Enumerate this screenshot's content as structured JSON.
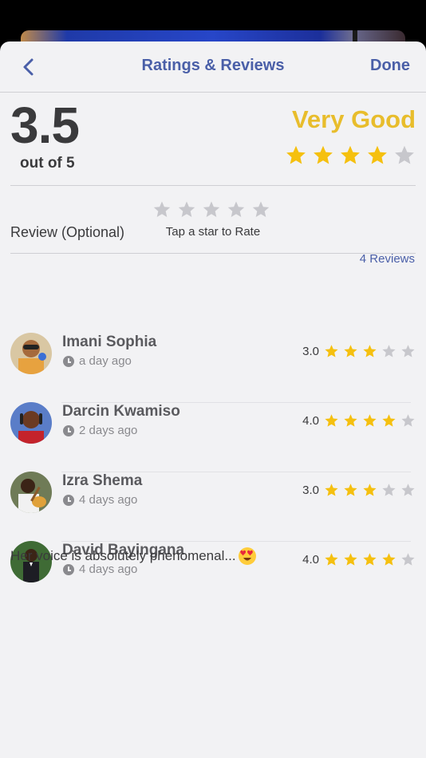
{
  "nav": {
    "title": "Ratings & Reviews",
    "done_label": "Done",
    "back_icon": "chevron-left-icon"
  },
  "summary": {
    "score": "3.5",
    "out_of": "out of 5",
    "verdict": "Very Good",
    "stars": 4,
    "max": 5
  },
  "rate": {
    "hint": "Tap a star to Rate",
    "selected": 0
  },
  "review_input": {
    "placeholder": "Review (Optional)"
  },
  "reviews_count": "4 Reviews",
  "colors": {
    "accent": "#4a5fa8",
    "star_on": "#f5c00f",
    "star_off": "#c7c7cc",
    "verdict": "#e8bd2c"
  },
  "reviews": [
    {
      "name": "Imani Sophia",
      "time": "a day ago",
      "rating": "3.0",
      "stars": 3
    },
    {
      "name": "Darcin Kwamiso",
      "time": "2 days ago",
      "rating": "4.0",
      "stars": 4
    },
    {
      "name": "Izra Shema",
      "time": "4 days ago",
      "rating": "3.0",
      "stars": 3
    },
    {
      "name": "David Bayingana",
      "time": "4 days ago",
      "rating": "4.0",
      "stars": 4,
      "comment": "Her voice is absolutely phenomenal..."
    }
  ]
}
